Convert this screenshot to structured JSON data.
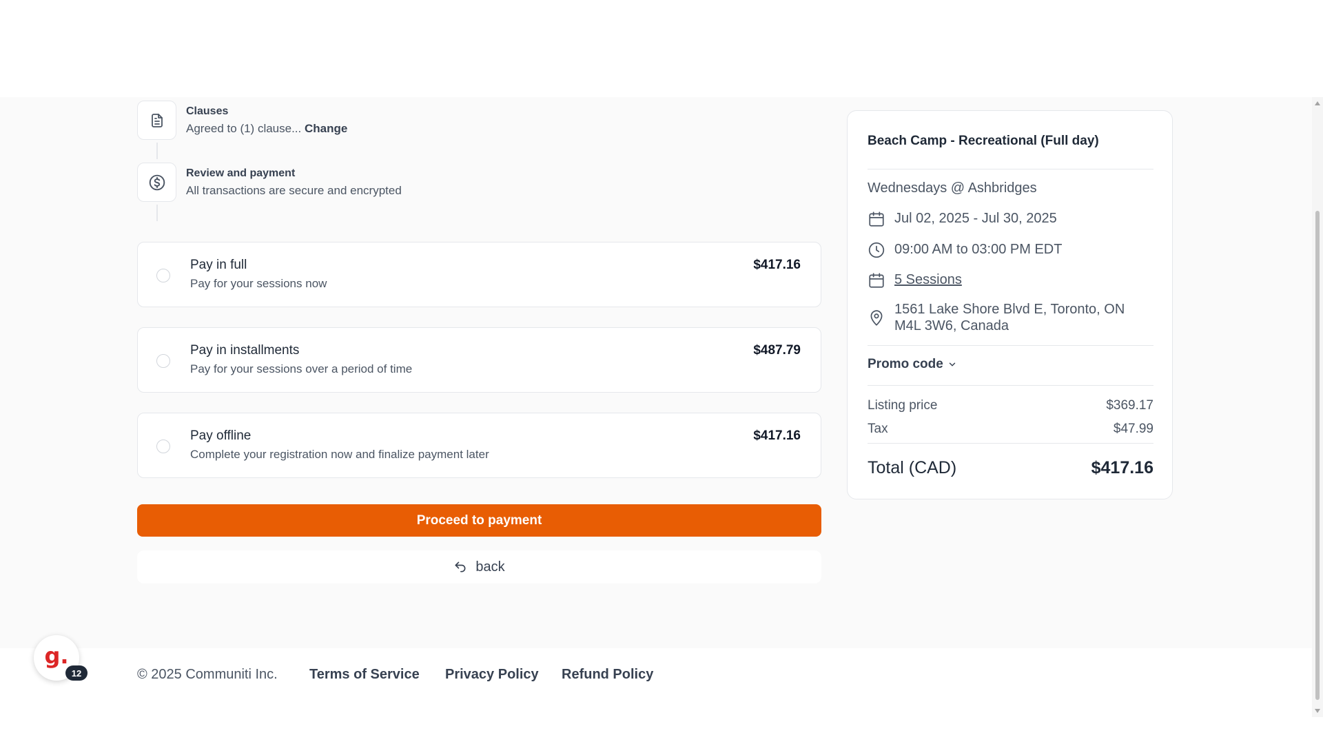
{
  "steps": {
    "clauses": {
      "title": "Clauses",
      "subtitle": "Agreed to (1) clause...",
      "change_label": "Change"
    },
    "review": {
      "title": "Review and payment",
      "subtitle": "All transactions are secure and encrypted"
    }
  },
  "payment_options": [
    {
      "title": "Pay in full",
      "subtitle": "Pay for your sessions now",
      "price": "$417.16"
    },
    {
      "title": "Pay in installments",
      "subtitle": "Pay for your sessions over a period of time",
      "price": "$487.79"
    },
    {
      "title": "Pay offline",
      "subtitle": "Complete your registration now and finalize payment later",
      "price": "$417.16"
    }
  ],
  "actions": {
    "proceed_label": "Proceed to payment",
    "back_label": "back"
  },
  "summary": {
    "title": "Beach Camp - Recreational (Full day)",
    "schedule_name": "Wednesdays @ Ashbridges",
    "date_range": "Jul 02, 2025 - Jul 30, 2025",
    "time_range": "09:00 AM to 03:00 PM EDT",
    "sessions": "5 Sessions",
    "address_line1": "1561 Lake Shore Blvd E, Toronto, ON",
    "address_line2": "M4L 3W6, Canada",
    "promo_label": "Promo code",
    "listing_price_label": "Listing price",
    "listing_price": "$369.17",
    "tax_label": "Tax",
    "tax": "$47.99",
    "total_label": "Total (CAD)",
    "total": "$417.16"
  },
  "footer": {
    "copyright": "© 2025 Communiti Inc.",
    "terms": "Terms of Service",
    "privacy": "Privacy Policy",
    "refund": "Refund Policy"
  },
  "widget": {
    "letter": "g.",
    "badge": "12"
  },
  "colors": {
    "accent": "#e85d04",
    "widget_red": "#dc2626"
  }
}
